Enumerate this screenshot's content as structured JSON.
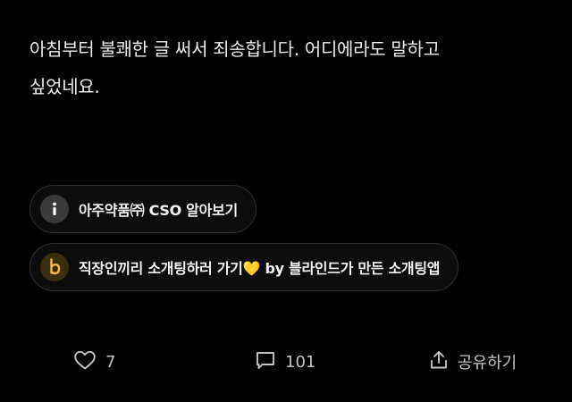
{
  "post": {
    "lines": [
      "아침부터 불쾌한 글 써서 죄송합니다. 어디에라도 말하고",
      "싶었네요."
    ]
  },
  "chips": [
    {
      "icon": "info-icon",
      "label": "아주약품㈜ CSO 알아보기"
    },
    {
      "icon": "blind-b-icon",
      "label": "직장인끼리 소개팅하러 가기💛 by 블라인드가 만든 소개팅앱"
    }
  ],
  "actions": {
    "like_count": "7",
    "comment_count": "101",
    "share_label": "공유하기"
  },
  "colors": {
    "background": "#000000",
    "chip_border": "#2e2e2e",
    "blind_accent": "#f2b84b"
  }
}
